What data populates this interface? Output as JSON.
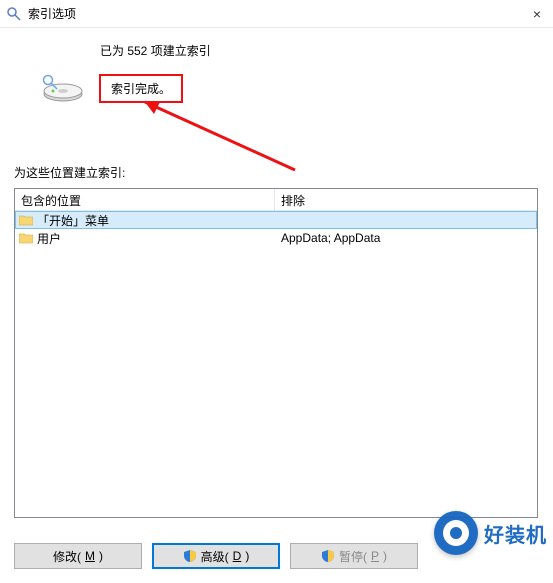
{
  "window": {
    "title": "索引选项",
    "close_glyph": "×"
  },
  "summary": "已为 552 项建立索引",
  "status": "索引完成。",
  "section_label": "为这些位置建立索引:",
  "table": {
    "header_included": "包含的位置",
    "header_excluded": "排除",
    "rows": [
      {
        "included": "「开始」菜单",
        "excluded": ""
      },
      {
        "included": "用户",
        "excluded": "AppData; AppData"
      }
    ]
  },
  "buttons": {
    "modify": {
      "label_pre": "修改(",
      "hotkey": "M",
      "label_post": ")"
    },
    "advanced": {
      "label_pre": "高级(",
      "hotkey": "D",
      "label_post": ")"
    },
    "pause": {
      "label_pre": "暂停(",
      "hotkey": "P",
      "label_post": ")"
    }
  },
  "watermark": {
    "text": "好装机"
  }
}
